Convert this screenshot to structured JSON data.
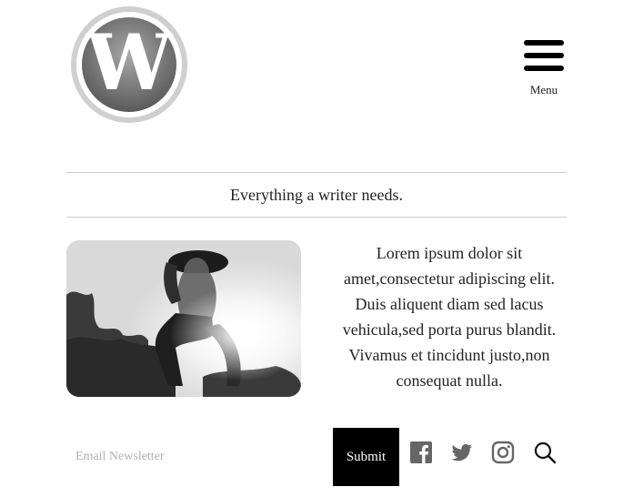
{
  "header": {
    "logo_icon": "wordpress-logo-icon",
    "menu_label": "Menu",
    "menu_icon": "hamburger-icon"
  },
  "tagline": "Everything a writer needs.",
  "intro_text": "Lorem ipsum dolor sit amet,consectetur adipiscing elit. Duis aliquent diam sed lacus vehicula,sed porta purus blandit. Vivamus et tincidunt justo,non consequat nulla.",
  "newsletter": {
    "placeholder": "Email Newsletter",
    "value": "",
    "submit_label": "Submit"
  },
  "social_icons": [
    "facebook-icon",
    "twitter-icon",
    "instagram-icon",
    "search-icon"
  ],
  "colors": {
    "accent": "#000000",
    "text": "#222222",
    "divider": "#cccccc",
    "placeholder": "#b0b0b0"
  }
}
